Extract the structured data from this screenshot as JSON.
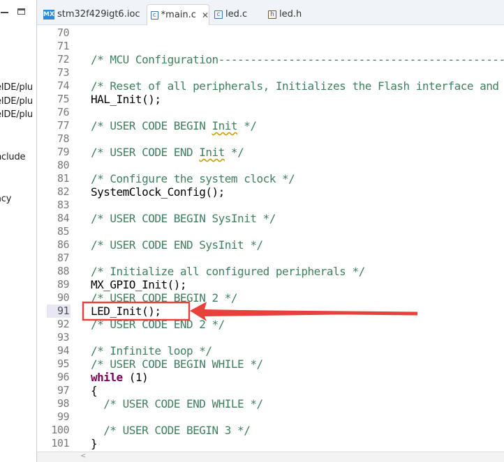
{
  "explorer": {
    "items": [
      {
        "label": "eIDE/plu",
        "row": 1
      },
      {
        "label": "eIDE/plu",
        "row": 2
      },
      {
        "label": "eIDE/plu",
        "row": 3
      },
      {
        "label": "nclude",
        "row": 4
      },
      {
        "label": "acy",
        "row": 5
      }
    ]
  },
  "tabs": [
    {
      "label": "stm32f429igt6.ioc",
      "icon": "mx-icon",
      "icon_text": "MX",
      "active": false
    },
    {
      "label": "*main.c",
      "icon": "c-file-icon",
      "icon_text": "c",
      "active": true,
      "close": "✕"
    },
    {
      "label": "led.c",
      "icon": "c-file-icon",
      "icon_text": "c",
      "active": false
    },
    {
      "label": "led.h",
      "icon": "h-file-icon",
      "icon_text": "h",
      "active": false
    }
  ],
  "editor": {
    "current_line": "91",
    "lines": [
      {
        "n": "70",
        "text": ""
      },
      {
        "n": "71",
        "text": ""
      },
      {
        "n": "72",
        "text": "/* MCU Configuration--------------------------------------------------------*/",
        "kind": "cmt"
      },
      {
        "n": "73",
        "text": ""
      },
      {
        "n": "74",
        "text": "/* Reset of all peripherals, Initializes the Flash interface and the Systick. */",
        "kind": "cmt"
      },
      {
        "n": "75",
        "text": "HAL_Init();",
        "kind": "plain"
      },
      {
        "n": "76",
        "text": ""
      },
      {
        "n": "77",
        "text": "/* USER CODE BEGIN Init */",
        "kind": "cmt"
      },
      {
        "n": "78",
        "text": ""
      },
      {
        "n": "79",
        "text": "/* USER CODE END Init */",
        "kind": "cmt"
      },
      {
        "n": "80",
        "text": ""
      },
      {
        "n": "81",
        "text": "/* Configure the system clock */",
        "kind": "cmt"
      },
      {
        "n": "82",
        "text": "SystemClock_Config();",
        "kind": "plain"
      },
      {
        "n": "83",
        "text": ""
      },
      {
        "n": "84",
        "text": "/* USER CODE BEGIN SysInit */",
        "kind": "cmt"
      },
      {
        "n": "85",
        "text": ""
      },
      {
        "n": "86",
        "text": "/* USER CODE END SysInit */",
        "kind": "cmt"
      },
      {
        "n": "87",
        "text": ""
      },
      {
        "n": "88",
        "text": "/* Initialize all configured peripherals */",
        "kind": "cmt"
      },
      {
        "n": "89",
        "text": "MX_GPIO_Init();",
        "kind": "plain"
      },
      {
        "n": "90",
        "text": "/* USER CODE BEGIN 2 */",
        "kind": "cmt"
      },
      {
        "n": "91",
        "text": "LED_Init();",
        "kind": "plain"
      },
      {
        "n": "92",
        "text": "/* USER CODE END 2 */",
        "kind": "cmt"
      },
      {
        "n": "93",
        "text": ""
      },
      {
        "n": "94",
        "text": "/* Infinite loop */",
        "kind": "cmt"
      },
      {
        "n": "95",
        "text": "/* USER CODE BEGIN WHILE */",
        "kind": "cmt"
      },
      {
        "n": "96",
        "text": "while (1)",
        "kind": "kw"
      },
      {
        "n": "97",
        "text": "{",
        "kind": "plain"
      },
      {
        "n": "98",
        "text": "  /* USER CODE END WHILE */",
        "kind": "cmt"
      },
      {
        "n": "99",
        "text": ""
      },
      {
        "n": "100",
        "text": "  /* USER CODE BEGIN 3 */",
        "kind": "cmt"
      },
      {
        "n": "101",
        "text": "}",
        "kind": "plain"
      }
    ]
  },
  "annotation": {
    "color": "#e8403a"
  },
  "colors": {
    "comment": "#3f7f5f",
    "keyword": "#7f0055",
    "line_number": "#787878"
  },
  "scrollbar": {
    "left_arrow": "<"
  }
}
